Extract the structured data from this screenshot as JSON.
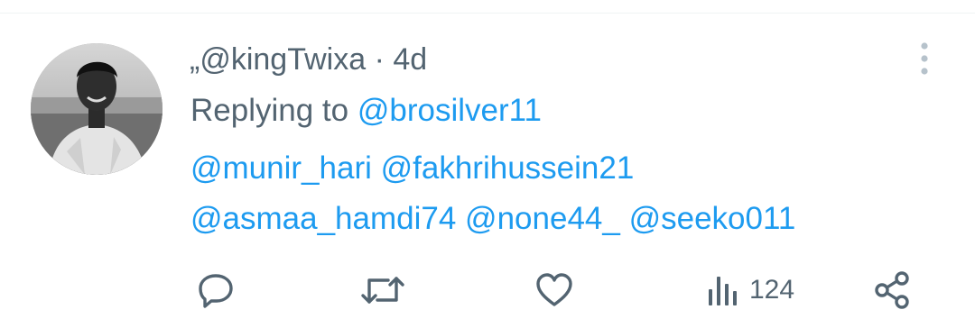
{
  "tweet": {
    "display_name": "„",
    "handle": "@kingTwixa",
    "separator": "·",
    "time": "4d",
    "replying_prefix": "Replying to",
    "replying_to": "@brosilver11",
    "mentions_line1": [
      "@munir_hari",
      "@fakhrihussein21"
    ],
    "mentions_line2": [
      "@asmaa_hamdi74",
      "@none44_",
      "@seeko011"
    ]
  },
  "actions": {
    "reply_icon": "reply-icon",
    "retweet_icon": "retweet-icon",
    "like_icon": "heart-icon",
    "views_icon": "views-icon",
    "views_count": "124",
    "share_icon": "share-icon"
  },
  "colors": {
    "text_secondary": "#536471",
    "accent": "#1d9bf0",
    "divider": "#eff3f4"
  }
}
